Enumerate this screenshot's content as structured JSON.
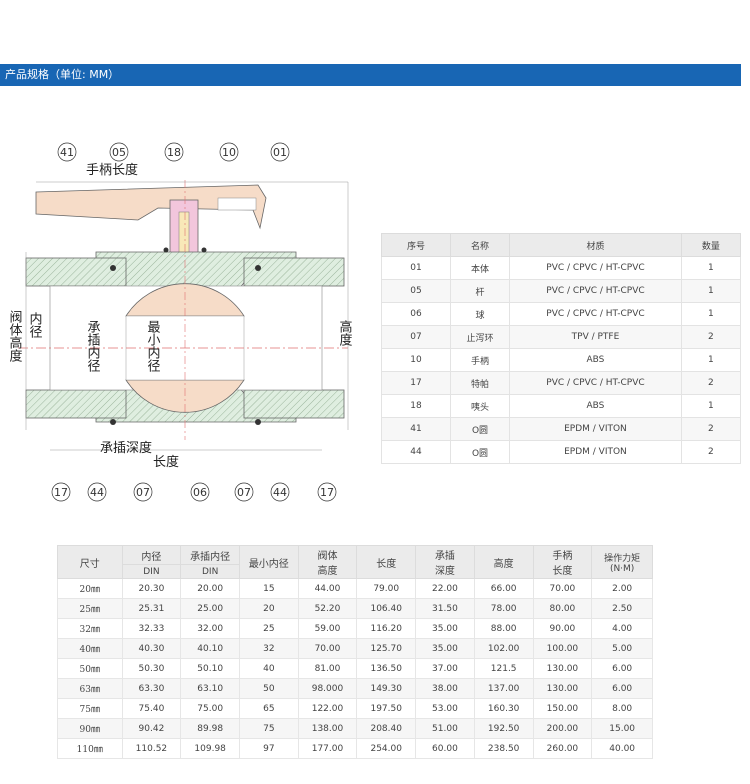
{
  "banner": {
    "title": "产品规格（单位: MM）"
  },
  "diagram": {
    "callouts_top": [
      "41",
      "05",
      "18",
      "10",
      "01"
    ],
    "callouts_bottom": [
      "17",
      "44",
      "07",
      "06",
      "07",
      "44",
      "17"
    ],
    "labels": {
      "handle_length": "手柄长度",
      "valve_body_height": "阀体高度",
      "inner_diameter": "内径",
      "socket_inner_diameter": "承插内径",
      "min_inner_diameter": "最小内径",
      "height": "高度",
      "socket_depth": "承插深度",
      "length": "长度"
    }
  },
  "parts_table": {
    "headers": [
      "序号",
      "名称",
      "材质",
      "数量"
    ],
    "rows": [
      [
        "01",
        "本体",
        "PVC / CPVC / HT-CPVC",
        "1"
      ],
      [
        "05",
        "杆",
        "PVC / CPVC / HT-CPVC",
        "1"
      ],
      [
        "06",
        "球",
        "PVC / CPVC / HT-CPVC",
        "1"
      ],
      [
        "07",
        "止泻环",
        "TPV / PTFE",
        "2"
      ],
      [
        "10",
        "手柄",
        "ABS",
        "1"
      ],
      [
        "17",
        "特帕",
        "PVC / CPVC / HT-CPVC",
        "2"
      ],
      [
        "18",
        "咦头",
        "ABS",
        "1"
      ],
      [
        "41",
        "O圆",
        "EPDM / VITON",
        "2"
      ],
      [
        "44",
        "O圆",
        "EPDM / VITON",
        "2"
      ]
    ]
  },
  "spec_table": {
    "headers": {
      "size": "尺寸",
      "inner_diameter": "内径",
      "inner_diameter_sub": "DIN",
      "socket_inner_diameter": "承插内径",
      "socket_inner_diameter_sub": "DIN",
      "min_inner_diameter": "最小内径",
      "valve_height_1": "阀体",
      "valve_height_2": "高度",
      "length": "长度",
      "socket_depth_1": "承插",
      "socket_depth_2": "深度",
      "height": "高度",
      "handle_length_1": "手柄",
      "handle_length_2": "长度",
      "torque_1": "操作力矩",
      "torque_2": "(N·M)"
    },
    "rows": [
      [
        "20㎜",
        "20.30",
        "20.00",
        "15",
        "44.00",
        "79.00",
        "22.00",
        "66.00",
        "70.00",
        "2.00"
      ],
      [
        "25㎜",
        "25.31",
        "25.00",
        "20",
        "52.20",
        "106.40",
        "31.50",
        "78.00",
        "80.00",
        "2.50"
      ],
      [
        "32㎜",
        "32.33",
        "32.00",
        "25",
        "59.00",
        "116.20",
        "35.00",
        "88.00",
        "90.00",
        "4.00"
      ],
      [
        "40㎜",
        "40.30",
        "40.10",
        "32",
        "70.00",
        "125.70",
        "35.00",
        "102.00",
        "100.00",
        "5.00"
      ],
      [
        "50㎜",
        "50.30",
        "50.10",
        "40",
        "81.00",
        "136.50",
        "37.00",
        "121.5",
        "130.00",
        "6.00"
      ],
      [
        "63㎜",
        "63.30",
        "63.10",
        "50",
        "98.000",
        "149.30",
        "38.00",
        "137.00",
        "130.00",
        "6.00"
      ],
      [
        "75㎜",
        "75.40",
        "75.00",
        "65",
        "122.00",
        "197.50",
        "53.00",
        "160.30",
        "150.00",
        "8.00"
      ],
      [
        "90㎜",
        "90.42",
        "89.98",
        "75",
        "138.00",
        "208.40",
        "51.00",
        "192.50",
        "200.00",
        "15.00"
      ],
      [
        "110㎜",
        "110.52",
        "109.98",
        "97",
        "177.00",
        "254.00",
        "60.00",
        "238.50",
        "260.00",
        "40.00"
      ]
    ]
  }
}
